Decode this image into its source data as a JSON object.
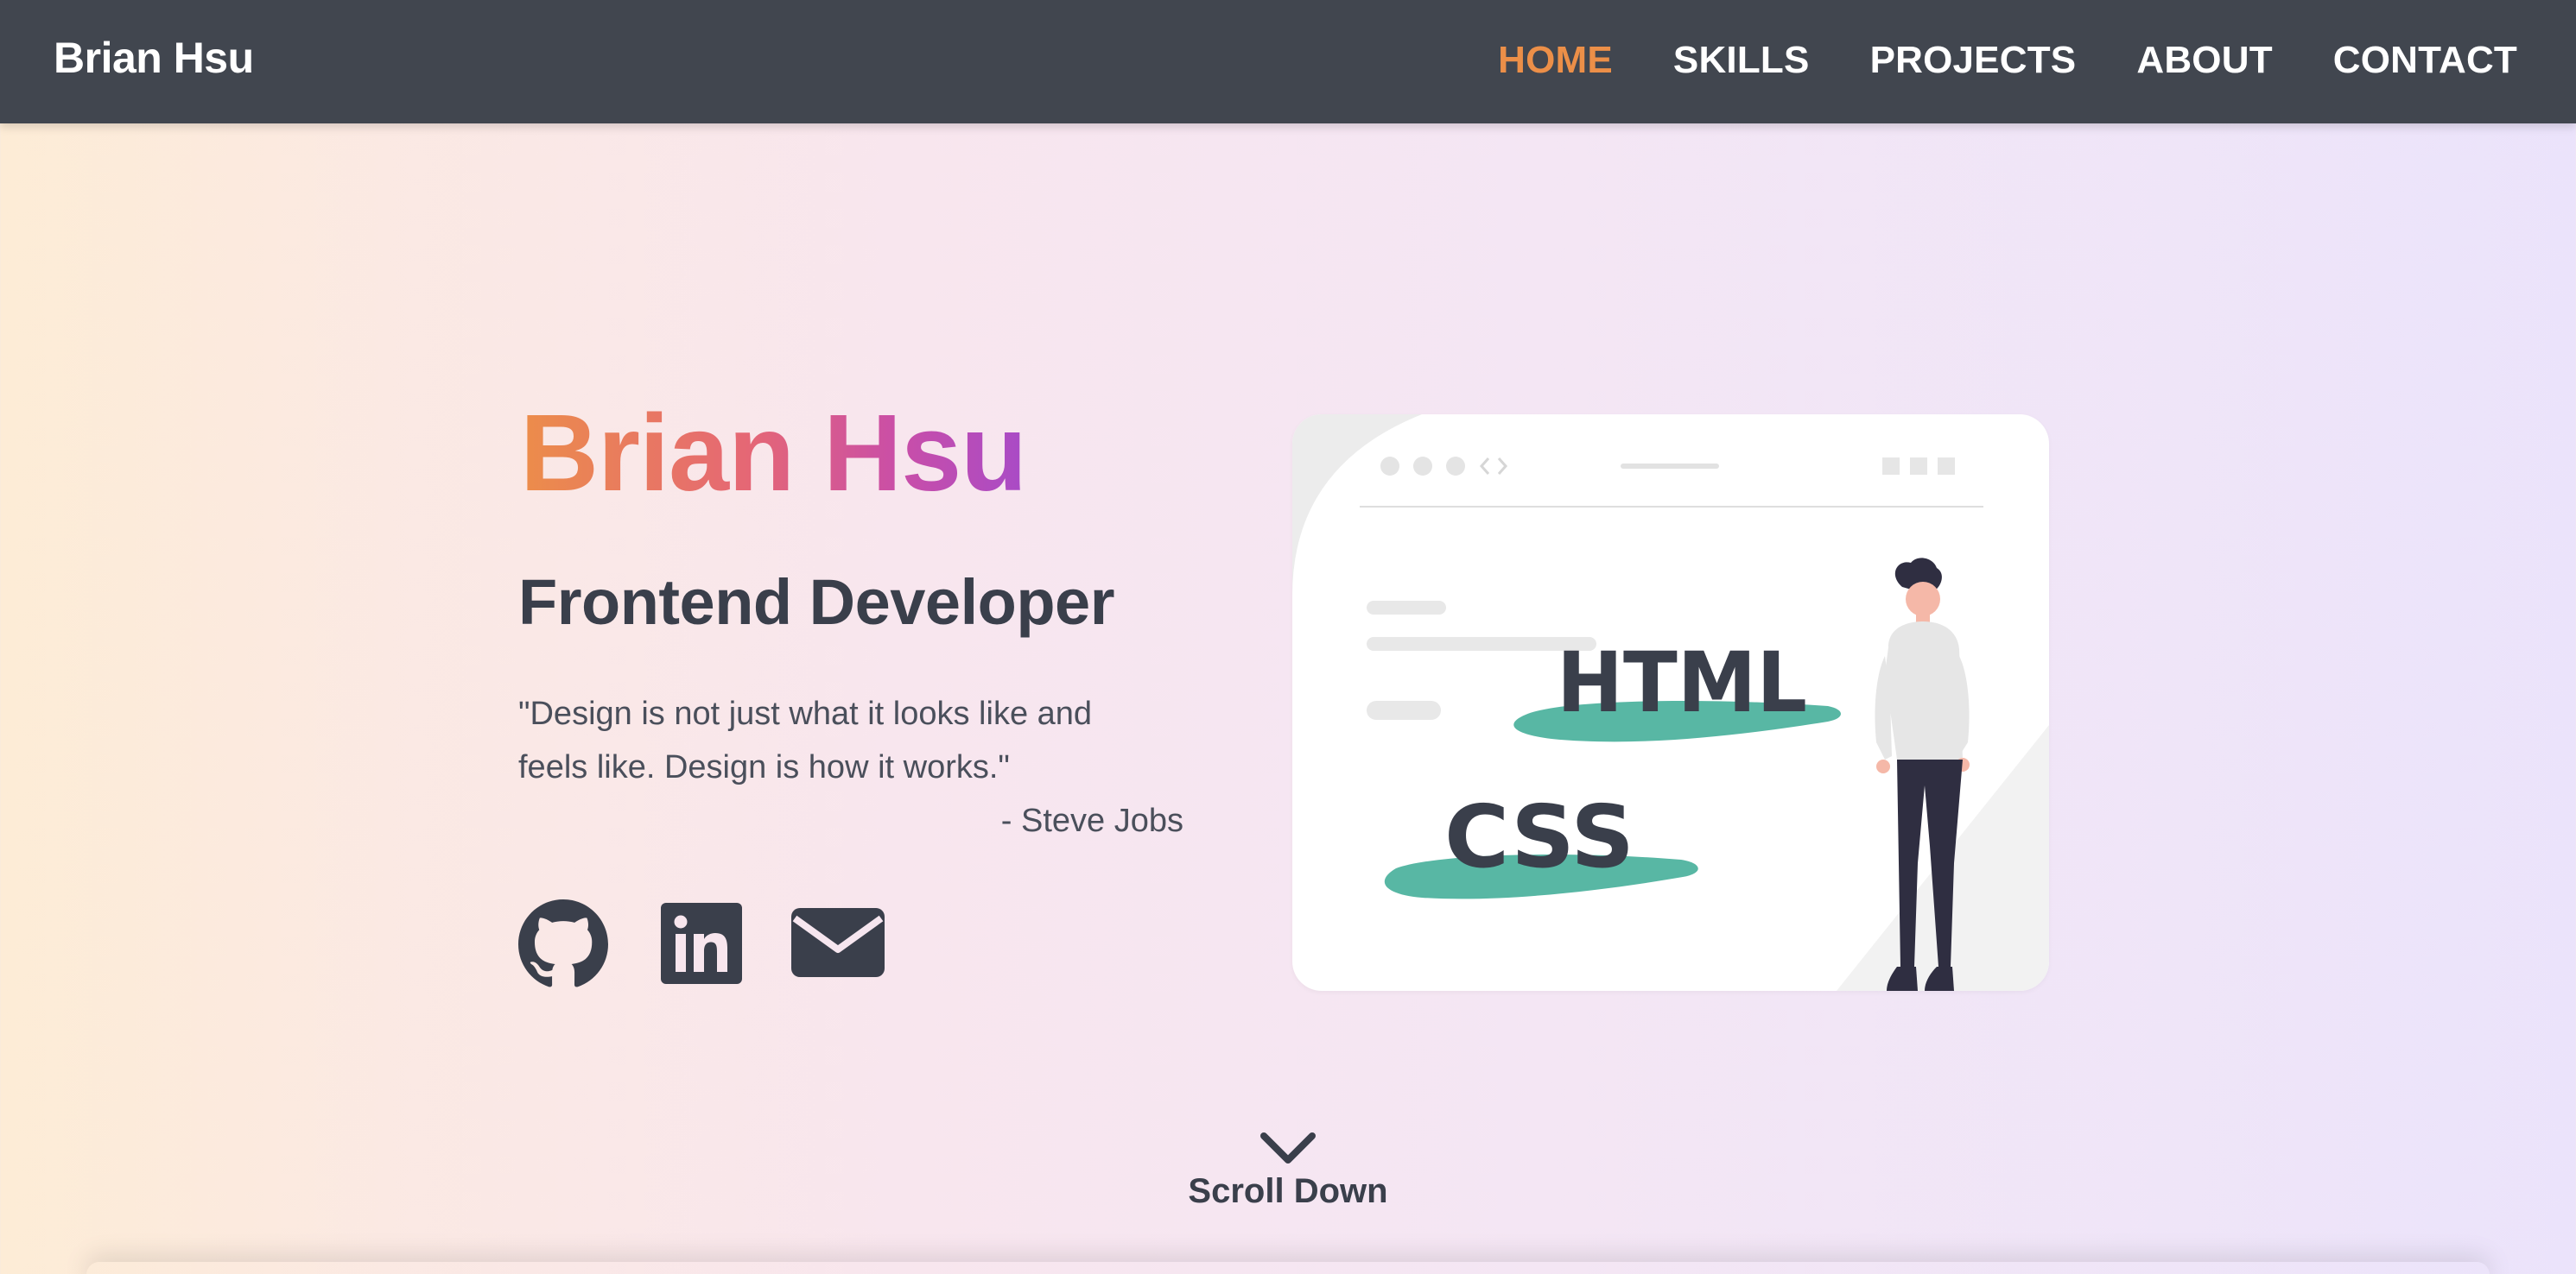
{
  "navbar": {
    "brand": "Brian Hsu",
    "links": [
      {
        "label": "HOME",
        "active": true
      },
      {
        "label": "SKILLS",
        "active": false
      },
      {
        "label": "PROJECTS",
        "active": false
      },
      {
        "label": "ABOUT",
        "active": false
      },
      {
        "label": "CONTACT",
        "active": false
      }
    ]
  },
  "hero": {
    "name": "Brian Hsu",
    "role": "Frontend Developer",
    "quote": "\"Design is not just what it looks like and feels like. Design is how it works.\"",
    "author": "- Steve Jobs",
    "socials": [
      {
        "icon": "github-icon"
      },
      {
        "icon": "linkedin-icon"
      },
      {
        "icon": "email-icon"
      }
    ]
  },
  "illustration": {
    "labels": [
      "HTML",
      "CSS"
    ]
  },
  "scroll": {
    "label": "Scroll Down",
    "icon": "chevron-down-icon"
  },
  "colors": {
    "navbar_bg": "#41464f",
    "accent": "#ec8f48",
    "text_dark": "#3a3f4b",
    "teal": "#58b7a4",
    "gradient_start": "#ec8d4a",
    "gradient_end": "#a84bc7"
  }
}
